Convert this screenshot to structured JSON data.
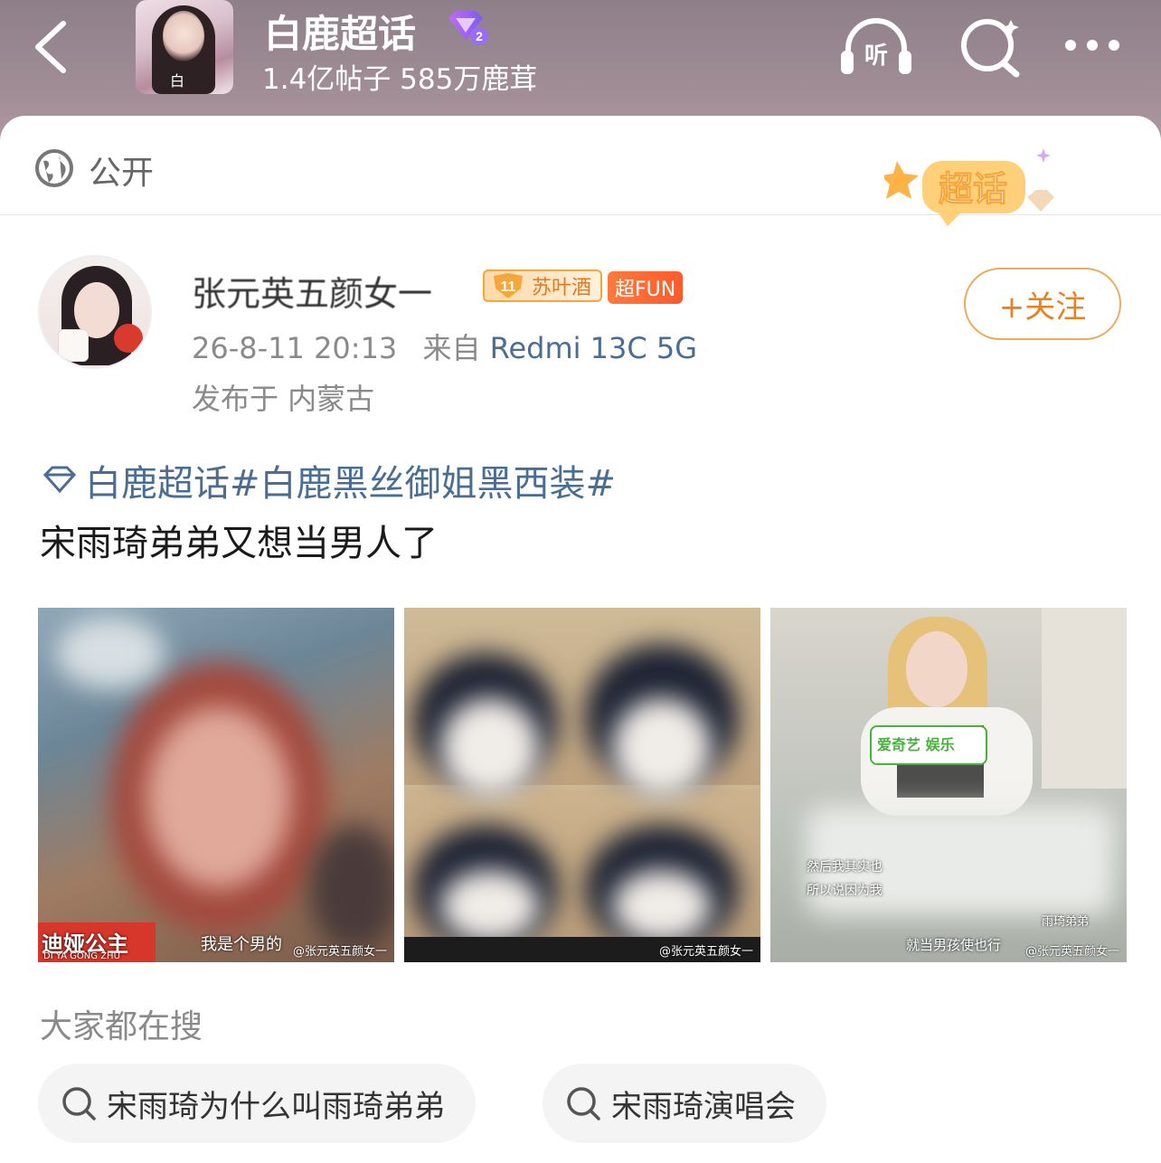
{
  "header": {
    "title": "白鹿超话",
    "subtitle": "1.4亿帖子 585万鹿茸",
    "cover_text": "白"
  },
  "visibility": {
    "label": "公开",
    "badge_text": "超话"
  },
  "author": {
    "name": "张元英五颜女一",
    "level_badge": "11",
    "level_label": "苏叶酒",
    "fun_badge": "超FUN",
    "time": "26-8-11 20:13",
    "source_prefix": "来自",
    "device": "Redmi 13C 5G",
    "location": "发布于 内蒙古",
    "follow_label": "+关注"
  },
  "post": {
    "topic": "白鹿超话#白鹿黑丝御姐黑西装#",
    "text": "宋雨琦弟弟又想当男人了"
  },
  "images": [
    {
      "caption_left": "迪娅公主",
      "caption_sub": "DI YA GONG ZHU",
      "subtitle": "我是个男的",
      "watermark": "@张元英五颜女一"
    },
    {
      "watermark": "@张元英五颜女一"
    },
    {
      "logo": "爱奇艺 娱乐",
      "line1": "然后我其实也",
      "line2": "所以说因为我",
      "line3": "就当男孩使也行",
      "line4": "雨琦弟弟",
      "watermark": "@张元英五颜女一"
    }
  ],
  "search": {
    "title": "大家都在搜",
    "chips": [
      "宋雨琦为什么叫雨琦弟弟",
      "宋雨琦演唱会"
    ]
  },
  "colors": {
    "topic_blue": "#4a6d93",
    "follow_orange": "#e8821e",
    "header_bg": "#a38f98"
  }
}
